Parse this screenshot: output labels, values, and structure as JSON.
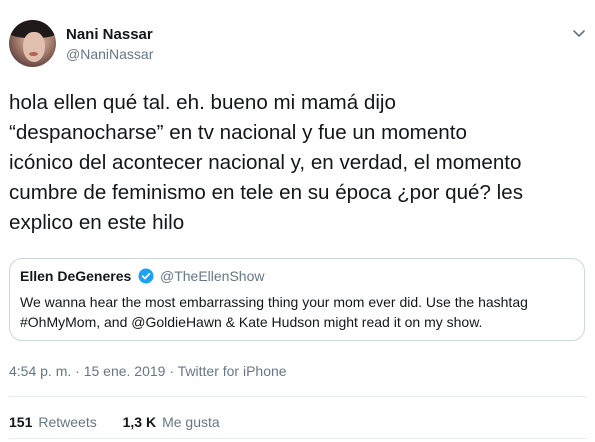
{
  "author": {
    "display_name": "Nani Nassar",
    "handle": "@NaniNassar"
  },
  "tweet": {
    "text": "hola ellen qué tal. eh. bueno mi mamá dijo\n“despanocharse” en tv nacional y fue un momento\nicónico del acontecer nacional y, en verdad, el momento\ncumbre de feminismo en tele en su época ¿por qué? les\nexplico en este hilo"
  },
  "quoted_tweet": {
    "display_name": "Ellen DeGeneres",
    "handle": "@TheEllenShow",
    "verified": true,
    "text": "We wanna hear the most embarrassing thing your mom ever did. Use the hashtag\n#OhMyMom, and @GoldieHawn & Kate Hudson might read it on my show."
  },
  "meta": {
    "timestamp": "4:54 p. m. · 15 ene. 2019 · Twitter for iPhone"
  },
  "stats": {
    "retweets_count": "151",
    "retweets_label": "Retweets",
    "likes_count": "1,3 K",
    "likes_label": "Me gusta"
  },
  "icons": {
    "menu": "chevron-down-icon",
    "verified": "verified-badge-icon"
  },
  "colors": {
    "text": "#14171a",
    "secondary": "#657786",
    "verified": "#1da1f2",
    "border": "#ccd6dd"
  }
}
